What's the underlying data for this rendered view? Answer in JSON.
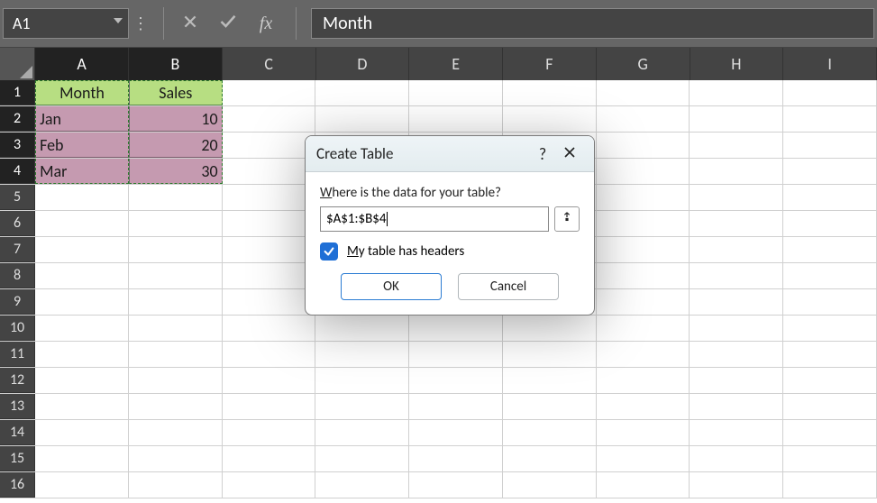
{
  "formula_bar": {
    "name_box": "A1",
    "fx_label": "fx",
    "formula_value": "Month"
  },
  "columns": [
    "A",
    "B",
    "C",
    "D",
    "E",
    "F",
    "G",
    "H",
    "I"
  ],
  "selected_cols": [
    "A",
    "B"
  ],
  "row_numbers": [
    1,
    2,
    3,
    4,
    5,
    6,
    7,
    8,
    9,
    10,
    11,
    12,
    13,
    14,
    15,
    16
  ],
  "selected_rows": [
    1,
    2,
    3,
    4
  ],
  "chart_data": {
    "type": "table",
    "headers": [
      "Month",
      "Sales"
    ],
    "rows": [
      {
        "Month": "Jan",
        "Sales": 10
      },
      {
        "Month": "Feb",
        "Sales": 20
      },
      {
        "Month": "Mar",
        "Sales": 30
      }
    ]
  },
  "dialog": {
    "title": "Create Table",
    "prompt_pre": "W",
    "prompt_rest": "here is the data for your table?",
    "range_value": "$A$1:$B$4",
    "checkbox_pre": "M",
    "checkbox_rest": "y table has headers",
    "checkbox_checked": true,
    "ok_label": "OK",
    "cancel_label": "Cancel"
  }
}
